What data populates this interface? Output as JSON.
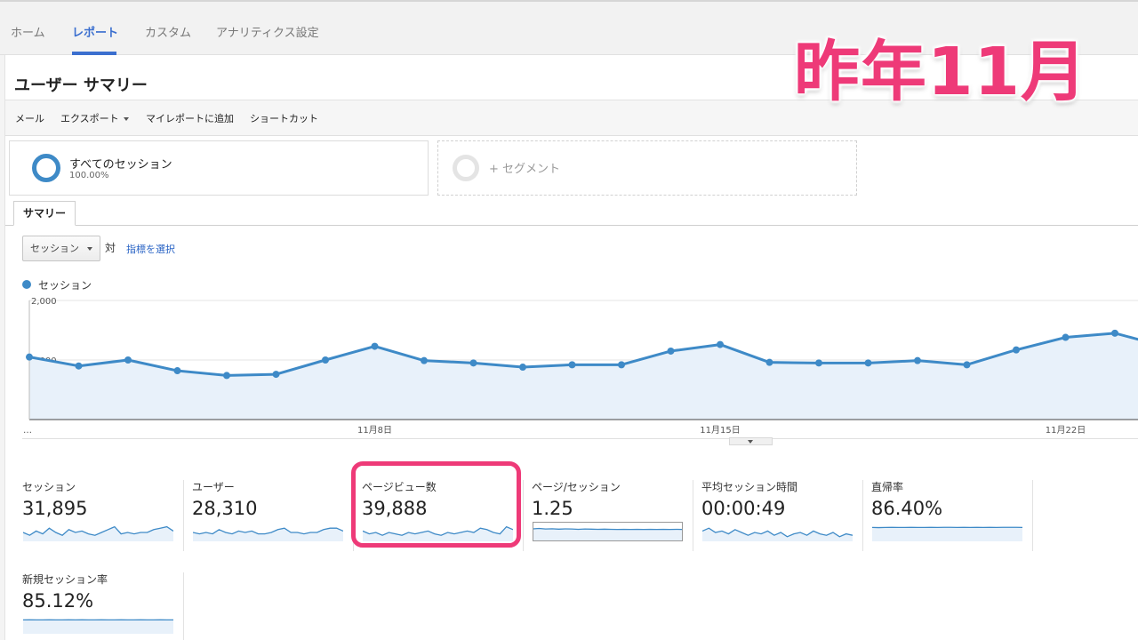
{
  "nav": {
    "tabs": [
      {
        "label": "ホーム"
      },
      {
        "label": "レポート",
        "active": true
      },
      {
        "label": "カスタム"
      },
      {
        "label": "アナリティクス設定"
      }
    ]
  },
  "page": {
    "title": "ユーザー サマリー"
  },
  "actions": {
    "mail": "メール",
    "export": "エクスポート",
    "add_to_dashboard": "マイレポートに追加",
    "shortcut": "ショートカット"
  },
  "segments": {
    "all": {
      "name": "すべてのセッション",
      "percent": "100.00%"
    },
    "add": {
      "label": "+ セグメント"
    }
  },
  "summary_tab": {
    "label": "サマリー"
  },
  "controls": {
    "metric_select": "セッション",
    "vs_label": "対",
    "select_metric_link": "指標を選択"
  },
  "legend": {
    "label": "セッション"
  },
  "colors": {
    "accent": "#3e8ac7",
    "nav_active": "#3b6fcf",
    "highlight": "#ee3a78",
    "area_fill": "#e8f1fa"
  },
  "chart_data": {
    "type": "area",
    "series": [
      {
        "name": "セッション",
        "values": [
          1050,
          900,
          1000,
          820,
          740,
          760,
          1000,
          1230,
          990,
          950,
          880,
          920,
          920,
          1150,
          1260,
          960,
          950,
          950,
          990,
          920,
          1170,
          1380,
          1450,
          1230
        ]
      }
    ],
    "y_ticks": [
      "2,000",
      "1,000"
    ],
    "ylim": [
      0,
      2000
    ],
    "x_ticks": [
      {
        "label": "…",
        "index": 0
      },
      {
        "label": "11月8日",
        "index": 7
      },
      {
        "label": "11月15日",
        "index": 14
      },
      {
        "label": "11月22日",
        "index": 21
      }
    ],
    "grid": true,
    "legend_position": "top-left"
  },
  "metrics": [
    {
      "label": "セッション",
      "value": "31,895",
      "spark": [
        0.5,
        0.3,
        0.6,
        0.4,
        0.8,
        0.5,
        0.3,
        0.7,
        0.5,
        0.6,
        0.4,
        0.3,
        0.5,
        0.7,
        0.9,
        0.4,
        0.5,
        0.4,
        0.5,
        0.5,
        0.7,
        0.8,
        0.9,
        0.6
      ]
    },
    {
      "label": "ユーザー",
      "value": "28,310",
      "spark": [
        0.5,
        0.4,
        0.5,
        0.4,
        0.7,
        0.5,
        0.4,
        0.6,
        0.5,
        0.6,
        0.4,
        0.4,
        0.5,
        0.7,
        0.8,
        0.5,
        0.5,
        0.4,
        0.5,
        0.5,
        0.7,
        0.8,
        0.8,
        0.6
      ]
    },
    {
      "label": "ページビュー数",
      "value": "39,888",
      "spark": [
        0.6,
        0.4,
        0.5,
        0.3,
        0.5,
        0.4,
        0.3,
        0.5,
        0.4,
        0.5,
        0.6,
        0.4,
        0.3,
        0.5,
        0.4,
        0.5,
        0.6,
        0.5,
        0.8,
        0.7,
        0.5,
        0.4,
        0.9,
        0.7
      ]
    },
    {
      "label": "ページ/セッション",
      "value": "1.25",
      "spark": [
        0.75,
        0.78,
        0.74,
        0.76,
        0.73,
        0.75,
        0.74,
        0.72,
        0.74,
        0.73,
        0.72,
        0.73,
        0.72,
        0.71,
        0.72,
        0.71,
        0.72,
        0.71,
        0.72,
        0.71,
        0.72,
        0.71,
        0.72,
        0.71
      ]
    },
    {
      "label": "平均セッション時間",
      "value": "00:00:49",
      "spark": [
        0.6,
        0.8,
        0.5,
        0.6,
        0.4,
        0.7,
        0.5,
        0.3,
        0.5,
        0.4,
        0.6,
        0.3,
        0.5,
        0.2,
        0.4,
        0.5,
        0.3,
        0.6,
        0.4,
        0.3,
        0.5,
        0.2,
        0.4,
        0.3
      ]
    },
    {
      "label": "直帰率",
      "value": "86.40%",
      "spark": [
        0.85,
        0.84,
        0.85,
        0.86,
        0.85,
        0.85,
        0.86,
        0.85,
        0.85,
        0.86,
        0.85,
        0.86,
        0.86,
        0.85,
        0.86,
        0.85,
        0.86,
        0.85,
        0.86,
        0.85,
        0.86,
        0.86,
        0.86,
        0.85
      ]
    },
    {
      "label": "新規セッション率",
      "value": "85.12%",
      "spark": [
        0.85,
        0.86,
        0.85,
        0.85,
        0.86,
        0.85,
        0.85,
        0.86,
        0.85,
        0.86,
        0.85,
        0.85,
        0.86,
        0.85,
        0.85,
        0.86,
        0.85,
        0.85,
        0.86,
        0.85,
        0.85,
        0.86,
        0.85,
        0.85
      ]
    }
  ],
  "overlay": {
    "caption": "昨年11月"
  }
}
